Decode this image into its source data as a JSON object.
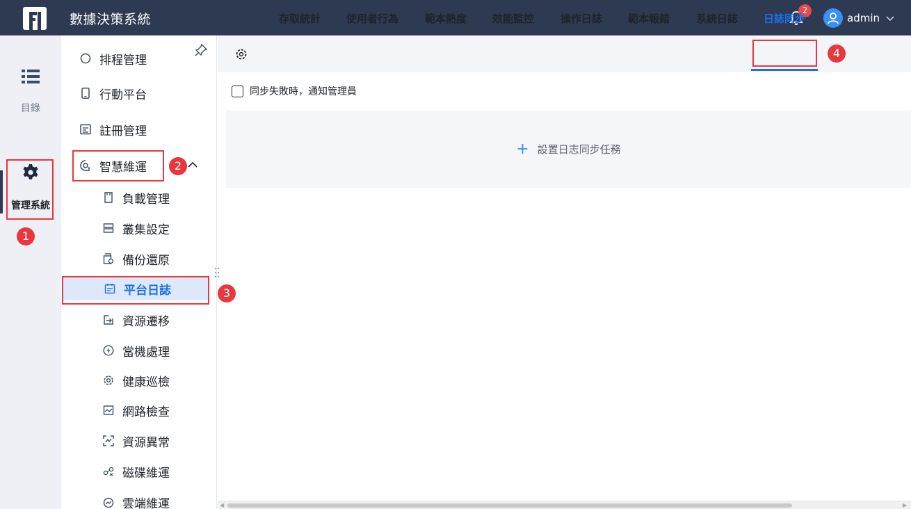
{
  "header": {
    "app_title": "數據決策系統",
    "notification_count": "2",
    "username": "admin"
  },
  "rail": {
    "items": [
      {
        "label": "目錄",
        "icon": "list-icon"
      },
      {
        "label": "管理系統",
        "icon": "gear-icon",
        "active": true
      }
    ]
  },
  "sidebar": {
    "items": [
      {
        "label": "排程管理",
        "icon": "clock-icon",
        "level": 1
      },
      {
        "label": "行動平台",
        "icon": "mobile-icon",
        "level": 1
      },
      {
        "label": "註冊管理",
        "icon": "register-icon",
        "level": 1
      },
      {
        "label": "智慧維運",
        "icon": "smart-ops-icon",
        "level": 1,
        "expanded": true
      },
      {
        "label": "負載管理",
        "icon": "load-icon",
        "level": 2
      },
      {
        "label": "叢集設定",
        "icon": "cluster-icon",
        "level": 2
      },
      {
        "label": "備份還原",
        "icon": "backup-icon",
        "level": 2
      },
      {
        "label": "平台日誌",
        "icon": "calendar-icon",
        "level": 2,
        "active": true
      },
      {
        "label": "資源遷移",
        "icon": "migrate-icon",
        "level": 2
      },
      {
        "label": "當機處理",
        "icon": "lightning-icon",
        "level": 2
      },
      {
        "label": "健康巡檢",
        "icon": "gear-icon",
        "level": 2
      },
      {
        "label": "網路檢查",
        "icon": "network-icon",
        "level": 2
      },
      {
        "label": "資源異常",
        "icon": "scan-icon",
        "level": 2
      },
      {
        "label": "磁碟維運",
        "icon": "disk-icon",
        "level": 2
      },
      {
        "label": "雲端維運",
        "icon": "cloud-icon",
        "level": 2
      }
    ]
  },
  "tabs": [
    {
      "label": "存取統計"
    },
    {
      "label": "使用者行為"
    },
    {
      "label": "範本熱度"
    },
    {
      "label": "效能監控"
    },
    {
      "label": "操作日誌"
    },
    {
      "label": "範本報錯"
    },
    {
      "label": "系統日誌"
    },
    {
      "label": "日誌同步",
      "active": true
    }
  ],
  "content": {
    "checkbox_label": "同步失敗時，通知管理員",
    "checkbox_checked": false,
    "add_task_label": "設置日志同步任務"
  },
  "annotations": [
    "1",
    "2",
    "3",
    "4"
  ],
  "colors": {
    "header_bg": "#2d3a52",
    "accent": "#1d6fe8",
    "annotation": "#e8383d"
  }
}
